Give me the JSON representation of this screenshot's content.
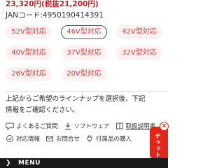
{
  "product": {
    "price": "23,320円(税抜21,200円)",
    "jan": "JANコード:4950190414391"
  },
  "sizes": [
    [
      "52V型対応",
      "46V型対応",
      "42V型対応"
    ],
    [
      "40V型対応",
      "37V型対応",
      "32V型対応"
    ],
    [
      "26V型対応",
      "20V型対応"
    ]
  ],
  "selected_size": "46V型対応",
  "notice": "上記からご希望のラインナップを選択後、下記情報をご確認ください。",
  "links": {
    "faq": "よくあるご質問",
    "software": "ソフトウェア",
    "manual": "取扱説明書",
    "compat": "対応情報",
    "contact": "お問合せ",
    "parts": "付属品の購入"
  },
  "chat": {
    "label": "チャット",
    "close": "×"
  },
  "footer": {
    "menu": "MENU",
    "chevron": "❯"
  },
  "colors": {
    "accent": "#d93a3a",
    "pill_bg": "#fdf1f1",
    "chat": "#e0261b",
    "footer": "#1a1a1a"
  }
}
